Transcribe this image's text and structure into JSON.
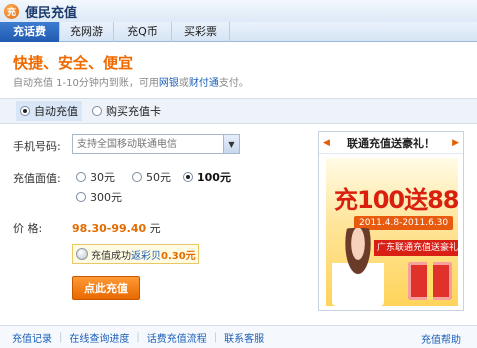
{
  "app": {
    "logo_text": "充",
    "title": "便民充值"
  },
  "tabs": [
    {
      "label": "充话费",
      "active": true
    },
    {
      "label": "充网游",
      "active": false
    },
    {
      "label": "充Q币",
      "active": false
    },
    {
      "label": "买彩票",
      "active": false
    }
  ],
  "header": {
    "headline": "快捷、安全、便宜",
    "sub_prefix": "自动充值  1-10分钟内到账，可用",
    "sub_link1": "网银",
    "sub_or": "或",
    "sub_link2": "财付通",
    "sub_suffix": "支付。"
  },
  "modes": [
    {
      "label": "自动充值",
      "selected": true
    },
    {
      "label": "购买充值卡",
      "selected": false
    }
  ],
  "form": {
    "phone_label": "手机号码:",
    "phone_placeholder": "支持全国移动联通电信",
    "amount_label": "充值面值:",
    "amounts": [
      {
        "label": "30元",
        "selected": false
      },
      {
        "label": "50元",
        "selected": false
      },
      {
        "label": "100元",
        "selected": true
      },
      {
        "label": "300元",
        "selected": false
      }
    ],
    "price_label": "价    格:",
    "price_value": "98.30-99.40",
    "price_unit": "元",
    "bonus_prefix": "充值成功",
    "bonus_link": "返彩贝",
    "bonus_value": "0.30元",
    "submit_label": "点此充值"
  },
  "ad": {
    "prev": "◀",
    "next": "▶",
    "title": "联通充值送豪礼！",
    "promo": "充100送88",
    "dates": "2011.4.8-2011.6.30",
    "strip": "广东联通充值送豪礼"
  },
  "footer": {
    "links": [
      "充值记录",
      "在线查询进度",
      "话费充值流程",
      "联系客服"
    ],
    "help": "充值帮助"
  }
}
